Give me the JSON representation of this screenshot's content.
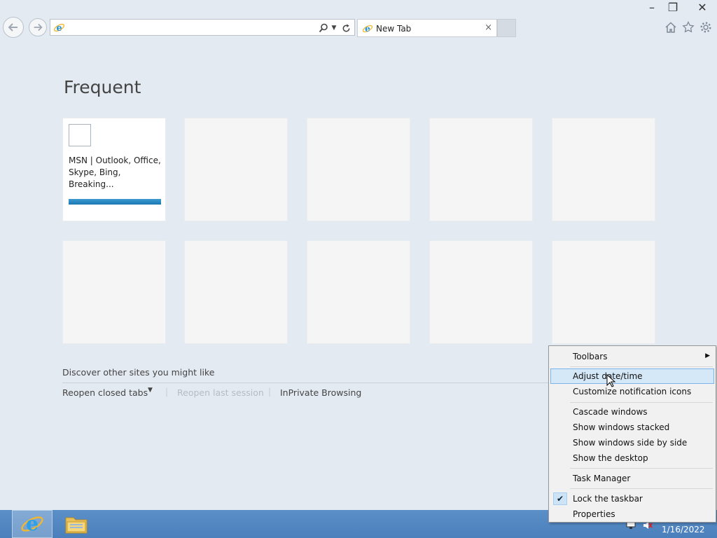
{
  "browser": {
    "tab_label": "New Tab",
    "tab_close": "×",
    "address_value": "",
    "address_placeholder": ""
  },
  "window_controls": {
    "minimize": "–",
    "restore": "❐",
    "close": "✕"
  },
  "new_tab_page": {
    "heading": "Frequent",
    "tiles": [
      {
        "title": "MSN | Outlook, Office, Skype, Bing, Breaking..."
      }
    ],
    "discover_text": "Discover other sites you might like",
    "reopen_closed_tabs": "Reopen closed tabs",
    "reopen_caret": "▼",
    "separator": "|",
    "reopen_last_session": "Reopen last session",
    "inprivate_browsing": "InPrivate Browsing"
  },
  "context_menu": {
    "items": [
      {
        "label": "Toolbars",
        "arrow": "▶"
      },
      {
        "label": "Adjust date/time"
      },
      {
        "label": "Customize notification icons"
      },
      {
        "label": "Cascade windows"
      },
      {
        "label": "Show windows stacked"
      },
      {
        "label": "Show windows side by side"
      },
      {
        "label": "Show the desktop"
      },
      {
        "label": "Task Manager"
      },
      {
        "label": "Lock the taskbar",
        "check": "✔"
      },
      {
        "label": "Properties"
      }
    ]
  },
  "taskbar": {
    "clock_date": "1/16/2022"
  },
  "colors": {
    "ie_blue": "#1f8fd8",
    "ie_ring": "#f2b731",
    "menu_highlight": "#d5e8f8",
    "taskbar": "#4a7fbc"
  }
}
